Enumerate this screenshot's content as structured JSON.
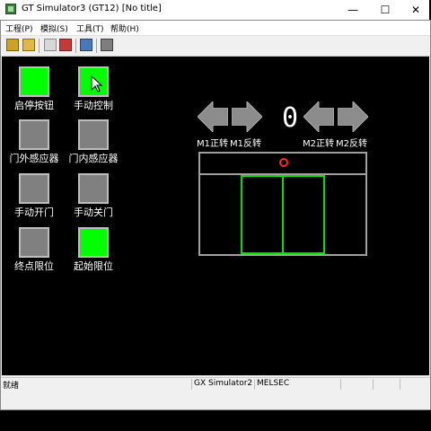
{
  "window": {
    "title": "GT Simulator3 (GT12)  [No title]",
    "controls": {
      "minimize": "—",
      "maximize": "☐",
      "close": "✕"
    }
  },
  "menu": [
    {
      "label": "工程(P)"
    },
    {
      "label": "模拟(S)"
    },
    {
      "label": "工具(T)"
    },
    {
      "label": "帮助(H)"
    }
  ],
  "toolbar": {
    "icons": [
      "open-project-icon",
      "open-folder-icon",
      "print-icon",
      "delete-icon",
      "monitor-icon",
      "device-icon"
    ]
  },
  "panel": {
    "lamps": [
      {
        "label": "启停按钮",
        "state": "on"
      },
      {
        "label": "手动控制",
        "state": "on"
      },
      {
        "label": "门外感应器",
        "state": "off"
      },
      {
        "label": "门内感应器",
        "state": "off"
      },
      {
        "label": "手动开门",
        "state": "off"
      },
      {
        "label": "手动关门",
        "state": "off"
      },
      {
        "label": "终点限位",
        "state": "off"
      },
      {
        "label": "起始限位",
        "state": "on"
      }
    ],
    "counter": "0",
    "motor_labels": {
      "m1_forward": "M1正转",
      "m1_reverse": "M1反转",
      "m2_forward": "M2正转",
      "m2_reverse": "M2反转"
    },
    "colors": {
      "lamp_on": "#00ff00",
      "lamp_off": "#808080",
      "door_leaf": "#00dd00",
      "indicator": "#ff2a2a"
    }
  },
  "status": {
    "left": "就绪",
    "simulator": "GX Simulator2",
    "plc": "MELSEC"
  }
}
